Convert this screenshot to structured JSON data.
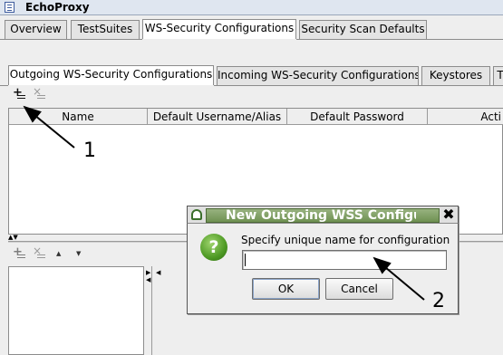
{
  "window": {
    "title": "EchoProxy"
  },
  "main_tabs": [
    "Overview",
    "TestSuites",
    "WS-Security Configurations",
    "Security Scan Defaults"
  ],
  "sub_tabs": [
    "Outgoing WS-Security Configurations",
    "Incoming WS-Security Configurations",
    "Keystores",
    "T"
  ],
  "table": {
    "columns": [
      "Name",
      "Default Username/Alias",
      "Default Password",
      "Acti"
    ]
  },
  "dialog": {
    "title": "New Outgoing WSS Configu",
    "message": "Specify unique name for configuration",
    "input_value": "",
    "ok_label": "OK",
    "cancel_label": "Cancel"
  },
  "annotations": {
    "label_1": "1",
    "label_2": "2"
  },
  "icons": [
    "document-icon",
    "add-icon",
    "remove-icon",
    "move-up-icon",
    "move-down-icon",
    "question-icon",
    "close-icon",
    "app-icon"
  ],
  "colors": {
    "dialog_title_bg": "#7fa063",
    "question_icon": "#4e9a24",
    "active_tab": "#ffffff"
  }
}
